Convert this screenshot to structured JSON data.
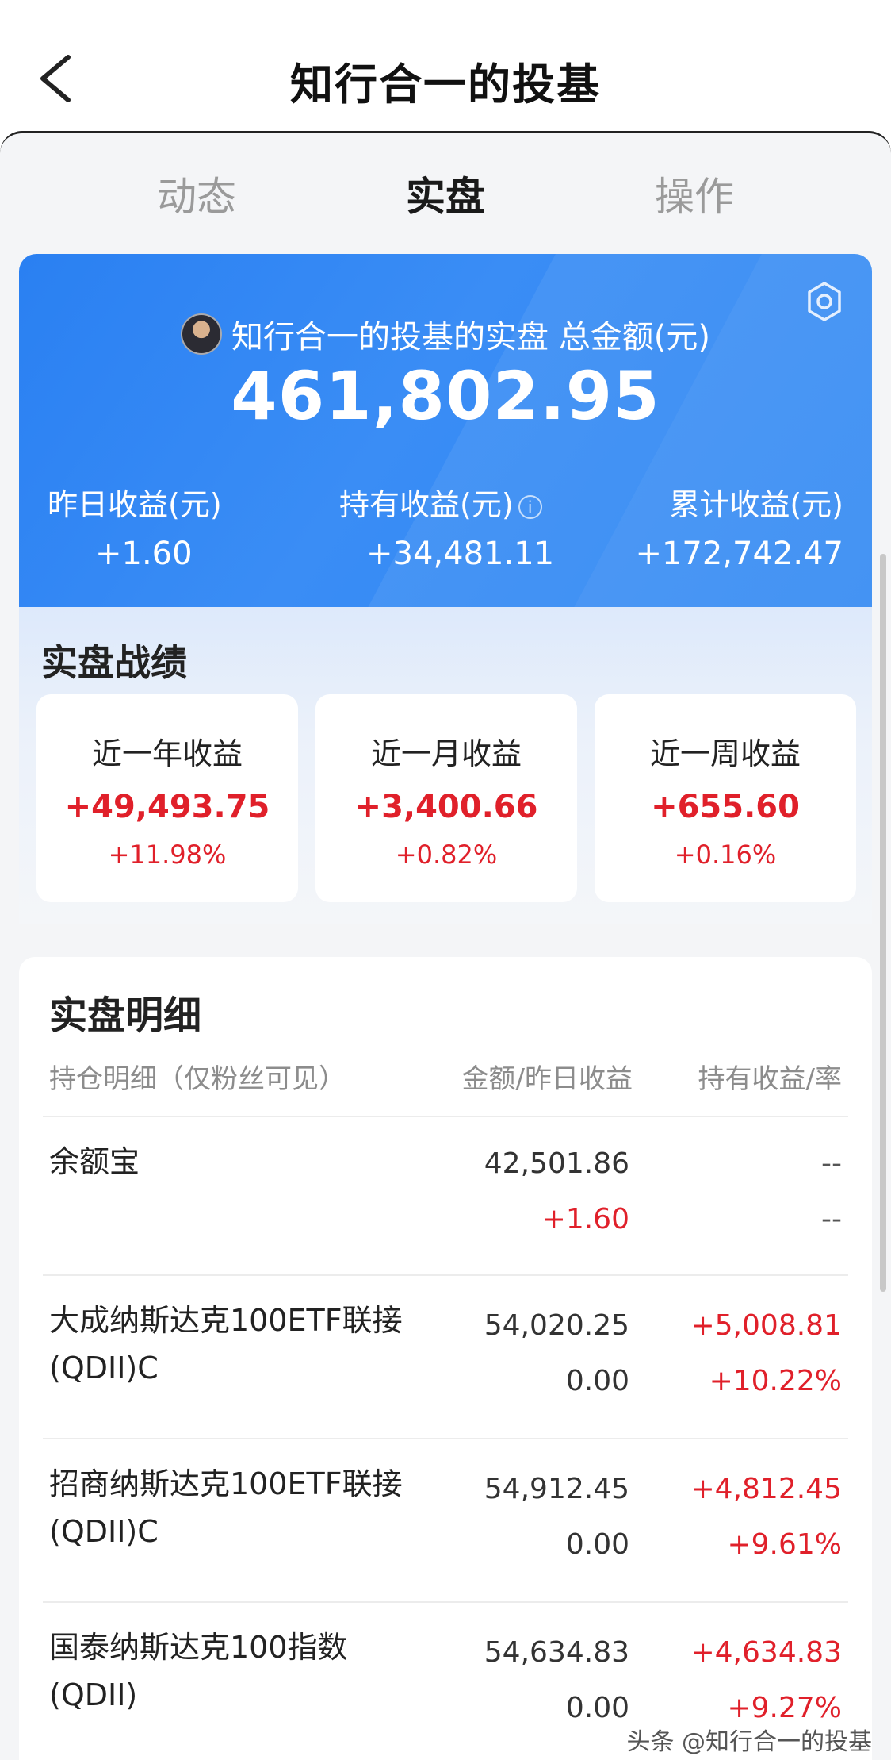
{
  "header": {
    "title": "知行合一的投基"
  },
  "tabs": [
    {
      "label": "动态"
    },
    {
      "label": "实盘"
    },
    {
      "label": "操作"
    }
  ],
  "summary": {
    "account_label": "知行合一的投基的实盘 总金额(元)",
    "total_amount": "461,802.95",
    "yesterday_label": "昨日收益(元)",
    "yesterday_value": "+1.60",
    "holding_label": "持有收益(元)",
    "holding_value": "+34,481.11",
    "cumulative_label": "累计收益(元)",
    "cumulative_value": "+172,742.47"
  },
  "performance": {
    "title": "实盘战绩",
    "cards": [
      {
        "label": "近一年收益",
        "amount": "+49,493.75",
        "percent": "+11.98%"
      },
      {
        "label": "近一月收益",
        "amount": "+3,400.66",
        "percent": "+0.82%"
      },
      {
        "label": "近一周收益",
        "amount": "+655.60",
        "percent": "+0.16%"
      }
    ]
  },
  "details": {
    "title": "实盘明细",
    "columns": [
      "持仓明细（仅粉丝可见）",
      "金额/昨日收益",
      "持有收益/率"
    ],
    "rows": [
      {
        "name": "余额宝",
        "amount": "42,501.86",
        "yesterday": "+1.60",
        "holding": "--",
        "rate": "--"
      },
      {
        "name": "大成纳斯达克100ETF联接(QDII)C",
        "amount": "54,020.25",
        "yesterday": "0.00",
        "holding": "+5,008.81",
        "rate": "+10.22%"
      },
      {
        "name": "招商纳斯达克100ETF联接(QDII)C",
        "amount": "54,912.45",
        "yesterday": "0.00",
        "holding": "+4,812.45",
        "rate": "+9.61%"
      },
      {
        "name": "国泰纳斯达克100指数(QDII)",
        "amount": "54,634.83",
        "yesterday": "0.00",
        "holding": "+4,634.83",
        "rate": "+9.27%"
      }
    ]
  },
  "watermark": "头条 @知行合一的投基",
  "colors": {
    "accent_blue": "#2c86f3",
    "gain_red": "#e0202a"
  }
}
